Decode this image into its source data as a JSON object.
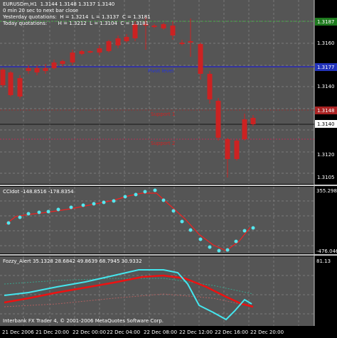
{
  "main_chart": {
    "symbol_line": "EURUSDm,H1  1.3144 1.3148 1.3137 1.3140",
    "countdown": "0 min 20 sec to next bar close",
    "yesterday": "Yesterday quotations:  H = 1.3214  L = 1.3137  C = 1.3181",
    "today": "Today quotations:       H = 1.3212  L = 1.3104  C = 1.3181",
    "price_axis": [
      "1.3187",
      "1.3160",
      "1.3177",
      "1.3148",
      "1.3140",
      "1.3120",
      "1.3105"
    ],
    "pivot_label": "Pivot level",
    "pivot_value": "1.3177",
    "support1_label": "Support 1",
    "support1_value": "1.3148",
    "support2_label": "Support 2",
    "current_price": "1.3140",
    "top_value": "1.3187",
    "colors": {
      "bull": "#3399ff",
      "bear": "#cc2222",
      "pivot": "#2222cc",
      "support": "#aa2222",
      "grid": "#888888"
    }
  },
  "cci_panel": {
    "label": "CCIdot -148.8516 -178.8354",
    "axis_top": "355.2989",
    "axis_bottom": "-476.0467"
  },
  "fozzy_panel": {
    "label": "Fozzy_Alert 35.1328 28.6842 49.8639 68.7945 30.9332",
    "axis_top": "81.13",
    "footer": "Interbank FX Trader 4, © 2001-2006 MetaQuotes Software Corp."
  },
  "time_axis": [
    "21 Dec 2006",
    "21 Dec 20:00",
    "22 Dec 00:00",
    "22 Dec 04:00",
    "22 Dec 08:00",
    "22 Dec 12:00",
    "22 Dec 16:00",
    "22 Dec 20:00"
  ]
}
